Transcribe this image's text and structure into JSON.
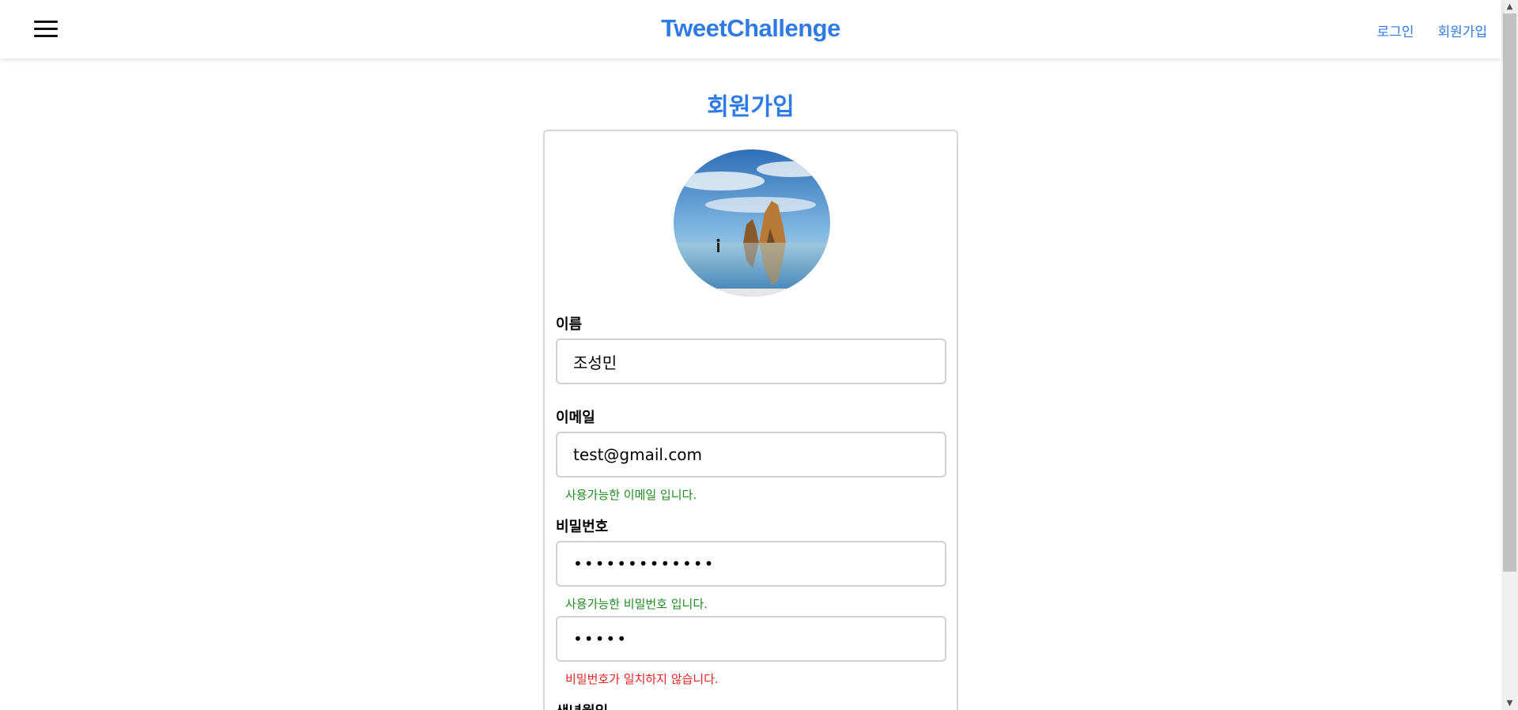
{
  "header": {
    "brand": "TweetChallenge",
    "menu_icon": "hamburger-menu-icon",
    "nav": {
      "login": "로그인",
      "signup": "회원가입"
    }
  },
  "page": {
    "title": "회원가입",
    "avatar_alt": "profile-image"
  },
  "form": {
    "name": {
      "label": "이름",
      "value": "조성민"
    },
    "email": {
      "label": "이메일",
      "value": "test@gmail.com",
      "message": "사용가능한 이메일 입니다."
    },
    "password": {
      "label": "비밀번호",
      "value": "•••••••••••••",
      "message": "사용가능한 비밀번호 입니다."
    },
    "password_confirm": {
      "value": "•••••",
      "message": "비밀번호가 일치하지 않습니다."
    },
    "birth": {
      "label": "생년월일"
    }
  },
  "colors": {
    "accent": "#2f7be6",
    "success": "#1f8a1f",
    "error": "#e22222"
  }
}
